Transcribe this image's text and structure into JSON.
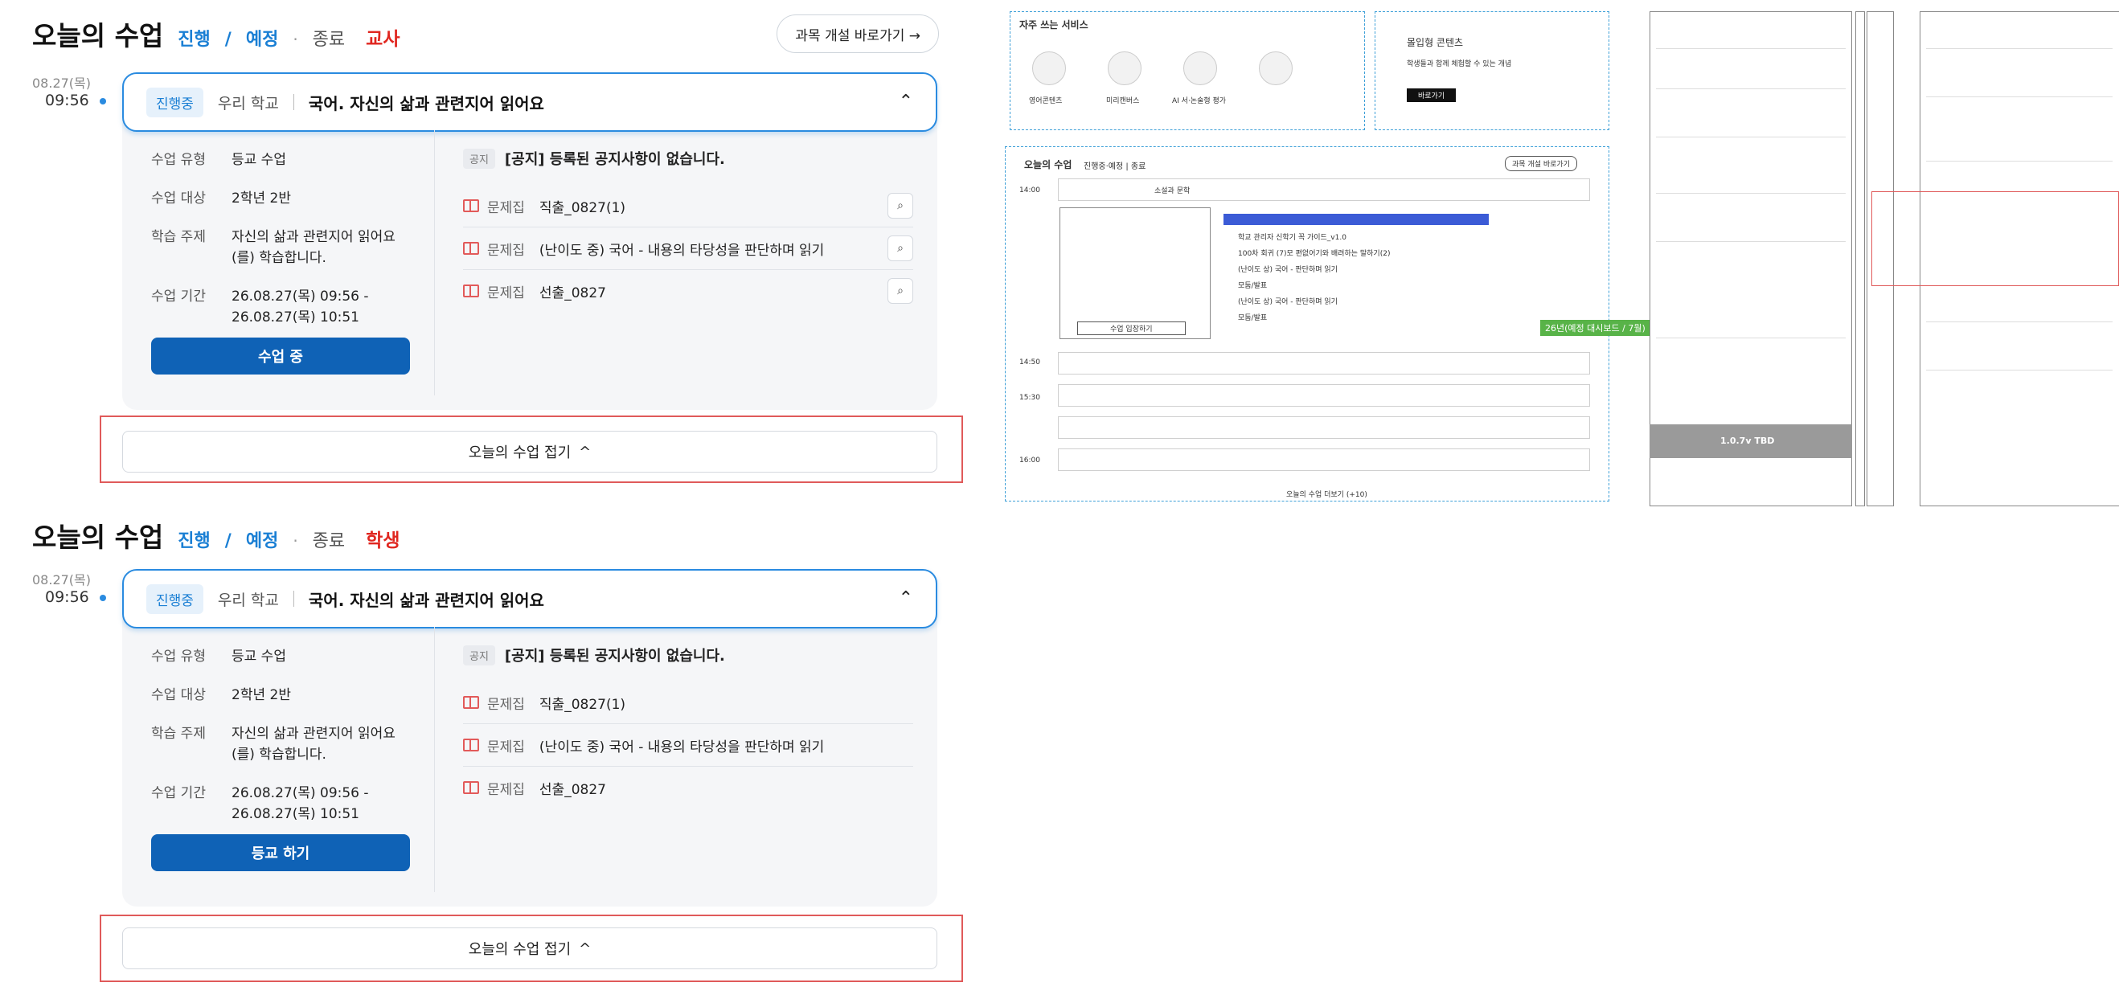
{
  "section_title": "오늘의 수업",
  "tabs": {
    "progress": "진행",
    "slash": "/",
    "scheduled": "예정",
    "dot": "·",
    "ended": "종료"
  },
  "open_course_button": "과목 개설 바로가기 →",
  "panels": [
    {
      "role": "교사",
      "date": "08.27(목)",
      "time": "09:56",
      "status_badge": "진행중",
      "school": "우리 학교",
      "subject": "국어. 자신의 삶과 관련지어 읽어요",
      "info": [
        {
          "label": "수업 유형",
          "value": "등교 수업"
        },
        {
          "label": "수업 대상",
          "value": "2학년 2반"
        },
        {
          "label": "학습 주제",
          "value": "자신의 삶과 관련지어 읽어요(를) 학습합니다."
        },
        {
          "label": "수업 기간",
          "value": "26.08.27(목) 09:56 - 26.08.27(목) 10:51"
        }
      ],
      "action_button": "수업 중",
      "notice_tag": "공지",
      "notice_text": "[공지] 등록된 공지사항이 없습니다.",
      "docs": [
        {
          "type": "문제집",
          "name": "직출_0827(1)"
        },
        {
          "type": "문제집",
          "name": "(난이도 중) 국어 - 내용의 타당성을 판단하며 읽기"
        },
        {
          "type": "문제집",
          "name": "선출_0827"
        }
      ],
      "fold_button": "오늘의 수업 접기",
      "fold_icon": "^"
    },
    {
      "role": "학생",
      "date": "08.27(목)",
      "time": "09:56",
      "status_badge": "진행중",
      "school": "우리 학교",
      "subject": "국어. 자신의 삶과 관련지어 읽어요",
      "info": [
        {
          "label": "수업 유형",
          "value": "등교 수업"
        },
        {
          "label": "수업 대상",
          "value": "2학년 2반"
        },
        {
          "label": "학습 주제",
          "value": "자신의 삶과 관련지어 읽어요(를) 학습합니다."
        },
        {
          "label": "수업 기간",
          "value": "26.08.27(목) 09:56 - 26.08.27(목) 10:51"
        }
      ],
      "action_button": "등교 하기",
      "notice_tag": "공지",
      "notice_text": "[공지] 등록된 공지사항이 없습니다.",
      "docs": [
        {
          "type": "문제집",
          "name": "직출_0827(1)"
        },
        {
          "type": "문제집",
          "name": "(난이도 중) 국어 - 내용의 타당성을 판단하며 읽기"
        },
        {
          "type": "문제집",
          "name": "선출_0827"
        }
      ],
      "fold_button": "오늘의 수업 접기",
      "fold_icon": "^"
    }
  ],
  "spec": {
    "services_title": "자주 쓰는 서비스",
    "services": [
      "영어콘텐츠",
      "미리캔버스",
      "AI 서·논술형 평가"
    ],
    "immersive_title": "몰입형 콘텐츠",
    "immersive_desc": "학생들과 함께 체험할 수 있는 개념",
    "immersive_btn": "바로가기",
    "lesson_title": "오늘의 수업",
    "lesson_tabs": "진행중·예정 | 종료",
    "open_course": "과목 개설 바로가기",
    "row_subject": "소설과 문학",
    "times": [
      "14:00",
      "14:50",
      "15:30",
      "16:00"
    ],
    "items": [
      "학교 관리자 신학기 꼭 가이드_v1.0",
      "100차 회귀 (7)모 편없어기와 배려하는 말하기(2)",
      "(난이도 상) 국어 - 판단하며 읽기",
      "모둠/발표",
      "(난이도 상) 국어 - 판단하며 읽기",
      "모둠/발표"
    ],
    "green_label": "26년(예정 대시보드 / 7월)",
    "class_info_btn": "수업 입장하기",
    "more": "오늘의 수업 더보기 (+10)",
    "tbd": "1.0.7v TBD"
  }
}
